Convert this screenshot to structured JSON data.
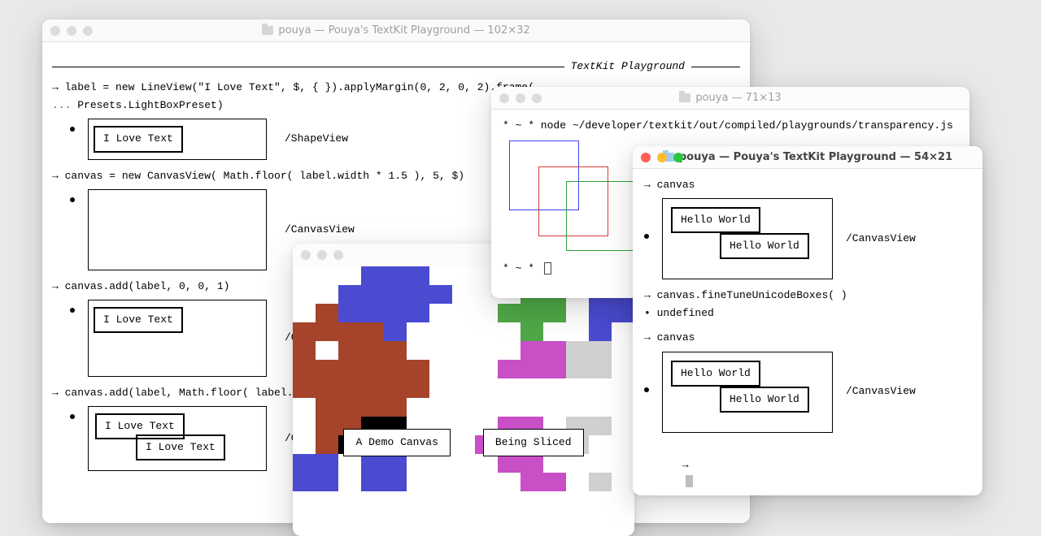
{
  "window1": {
    "title": "pouya — Pouya's TextKit Playground — 102×32",
    "header": "TextKit Playground",
    "code1": "label = new LineView(\"I Love Text\", $, { }).applyMargin(0, 2, 0, 2).frame(",
    "code1b": "Presets.LightBoxPreset)",
    "boxLabel": "I Love Text",
    "cap1": "/ShapeView",
    "code2": "canvas = new CanvasView( Math.floor( label.width * 1.5 ), 5, $)",
    "cap2": "/CanvasView",
    "code3": "canvas.add(label, 0, 0, 1)",
    "cap3": "/CanvasV",
    "code4": "canvas.add(label, Math.floor( label.",
    "cap4": "/CanvasV"
  },
  "window2": {
    "label1": "A Demo Canvas",
    "label2": "Being Sliced"
  },
  "window3": {
    "title": "pouya — 71×13",
    "cmd": "* ~ * node ~/developer/textkit/out/compiled/playgrounds/transparency.js",
    "prompt": "* ~ *"
  },
  "window4": {
    "title": "pouya — Pouya's TextKit Playground — 54×21",
    "line1": "canvas",
    "hello": "Hello World",
    "cap": "/CanvasView",
    "line2": "canvas.fineTuneUnicodeBoxes( )",
    "line3": "undefined",
    "line4": "canvas",
    "prompt": "→"
  }
}
